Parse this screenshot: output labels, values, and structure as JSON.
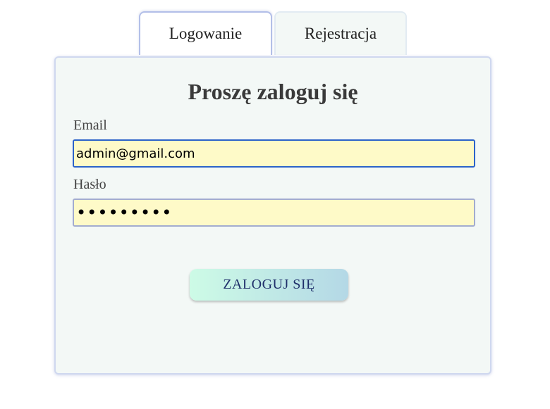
{
  "tabs": {
    "login_label": "Logowanie",
    "register_label": "Rejestracja",
    "active": "Logowanie"
  },
  "login_form": {
    "title": "Proszę zaloguj się",
    "email_label": "Email",
    "email_value": "admin@gmail.com",
    "password_label": "Hasło",
    "password_value": "•••••••••",
    "submit_label": "ZALOGUJ SIĘ"
  },
  "colors": {
    "input_background": "#fefac8",
    "focused_border": "#2c63c9",
    "panel_background": "#f3f8f6",
    "button_gradient_start": "#cdfbe6",
    "button_gradient_end": "#b4d8e6",
    "button_text": "#1f2f6a"
  }
}
